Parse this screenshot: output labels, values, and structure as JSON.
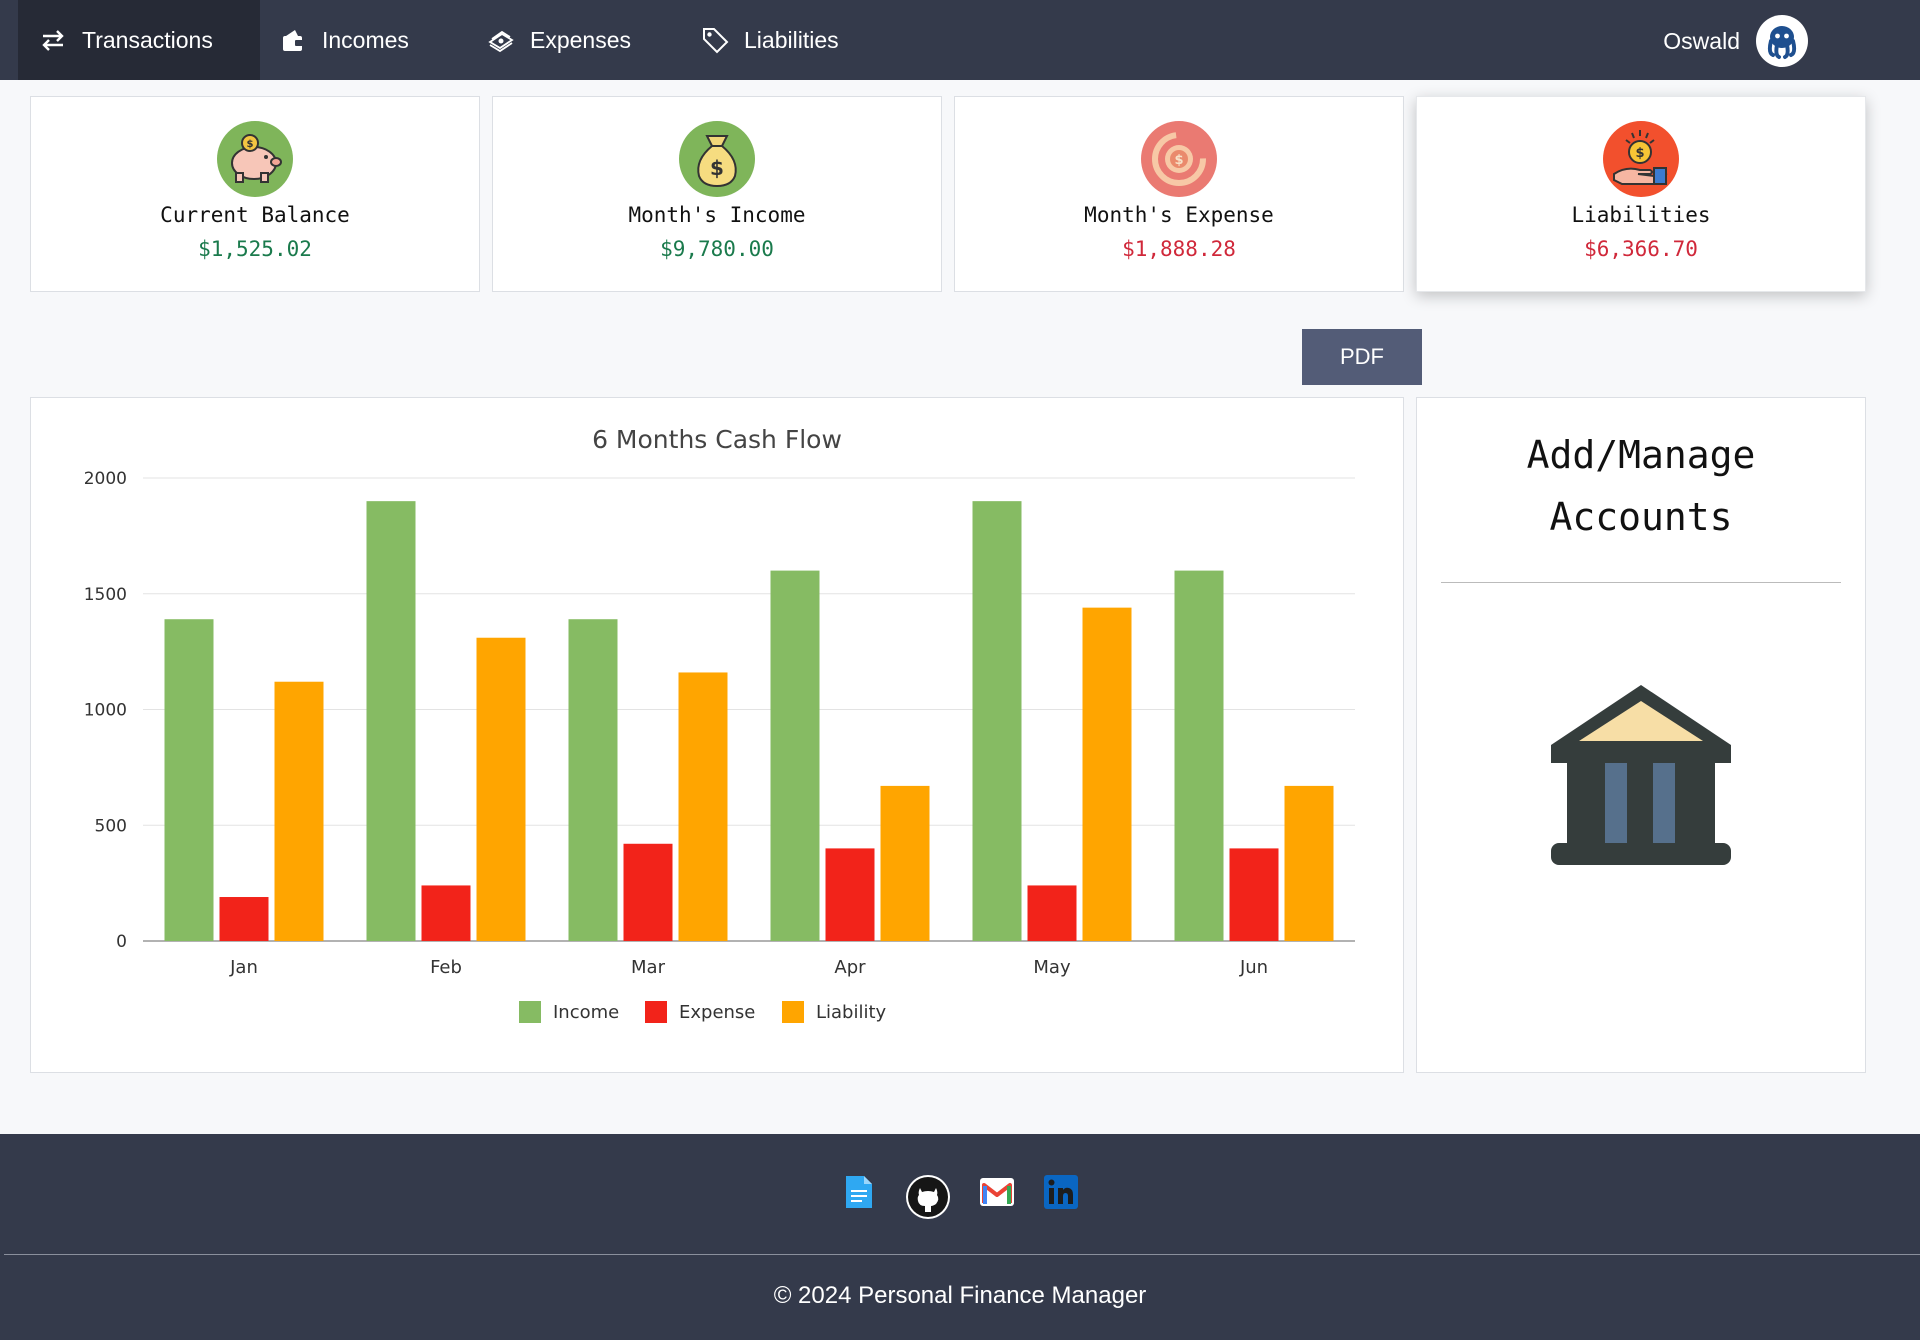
{
  "nav": {
    "items": [
      {
        "label": "Transactions",
        "icon": "transfer-arrows-icon",
        "active": true
      },
      {
        "label": "Incomes",
        "icon": "wallet-icon"
      },
      {
        "label": "Expenses",
        "icon": "money-stack-icon"
      },
      {
        "label": "Liabilities",
        "icon": "price-tag-icon"
      }
    ],
    "user": {
      "name": "Oswald",
      "avatar": "octopus-avatar-icon"
    }
  },
  "summary_cards": [
    {
      "label": "Current Balance",
      "value": "$1,525.02",
      "icon": "piggy-bank-icon",
      "tone": "positive"
    },
    {
      "label": "Month's Income",
      "value": "$9,780.00",
      "icon": "money-bag-icon",
      "tone": "positive"
    },
    {
      "label": "Month's Expense",
      "value": "$1,888.28",
      "icon": "coin-expense-icon",
      "tone": "negative"
    },
    {
      "label": "Liabilities",
      "value": "$6,366.70",
      "icon": "hand-coin-icon",
      "tone": "negative"
    }
  ],
  "actions": {
    "pdf_label": "PDF"
  },
  "chart_data": {
    "type": "bar",
    "title": "6 Months Cash Flow",
    "xlabel": "",
    "ylabel": "",
    "categories": [
      "Jan",
      "Feb",
      "Mar",
      "Apr",
      "May",
      "Jun"
    ],
    "series": [
      {
        "name": "Income",
        "color": "#86bb63",
        "values": [
          1390,
          1900,
          1390,
          1600,
          1900,
          1600
        ]
      },
      {
        "name": "Expense",
        "color": "#f2231a",
        "values": [
          190,
          240,
          420,
          400,
          240,
          400
        ]
      },
      {
        "name": "Liability",
        "color": "#ffa500",
        "values": [
          1120,
          1310,
          1160,
          670,
          1440,
          670
        ]
      }
    ],
    "ylim": [
      0,
      2000
    ],
    "yticks": [
      0,
      500,
      1000,
      1500,
      2000
    ],
    "grid": true,
    "legend": "bottom"
  },
  "accounts": {
    "title_line1": "Add/Manage",
    "title_line2": "Accounts",
    "icon": "bank-building-icon"
  },
  "footer": {
    "links": [
      {
        "icon": "document-icon"
      },
      {
        "icon": "github-icon"
      },
      {
        "icon": "gmail-icon"
      },
      {
        "icon": "linkedin-icon"
      }
    ],
    "copyright": "© 2024 Personal Finance Manager"
  }
}
